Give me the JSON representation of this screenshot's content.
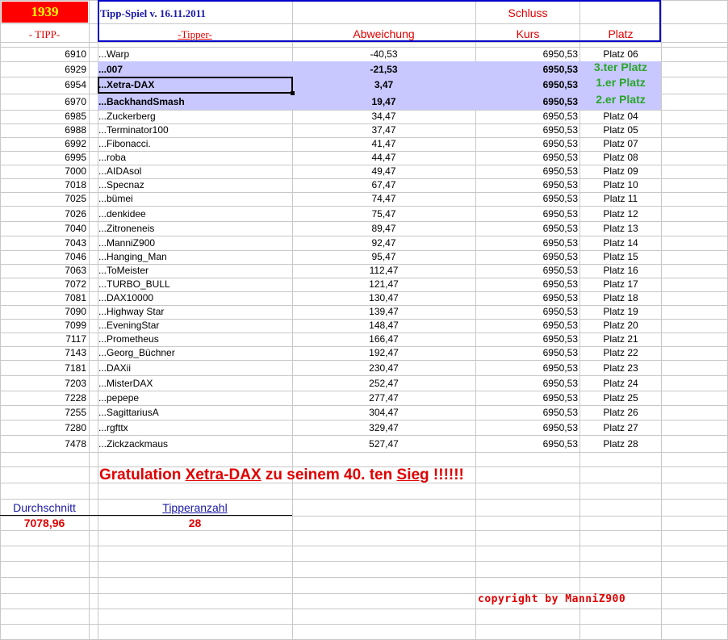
{
  "header": {
    "year": "1939",
    "title": "Tipp-Spiel v. 16.11.2011",
    "schluss": "Schluss",
    "col_tipp": "- TIPP-",
    "col_tipper": "-Tipper-",
    "col_abweichung": "Abweichung",
    "col_kurs": "Kurs",
    "col_platz": "Platz"
  },
  "rows": [
    {
      "tipp": "6910",
      "tipper": "...Warp",
      "abw": "-40,53",
      "kurs": "6950,53",
      "platz": "Platz 06",
      "hl": false,
      "rank": false
    },
    {
      "tipp": "6929",
      "tipper": "...007",
      "abw": "-21,53",
      "kurs": "6950,53",
      "platz": "3.ter Platz",
      "hl": true,
      "rank": true
    },
    {
      "tipp": "6954",
      "tipper": "...Xetra-DAX",
      "abw": "3,47",
      "kurs": "6950,53",
      "platz": "1.er Platz",
      "hl": true,
      "rank": true
    },
    {
      "tipp": "6970",
      "tipper": "...BackhandSmash",
      "abw": "19,47",
      "kurs": "6950,53",
      "platz": "2.er Platz",
      "hl": true,
      "rank": true
    },
    {
      "tipp": "6985",
      "tipper": "...Zuckerberg",
      "abw": "34,47",
      "kurs": "6950,53",
      "platz": "Platz 04",
      "hl": false,
      "rank": false
    },
    {
      "tipp": "6988",
      "tipper": "...Terminator100",
      "abw": "37,47",
      "kurs": "6950,53",
      "platz": "Platz 05",
      "hl": false,
      "rank": false
    },
    {
      "tipp": "6992",
      "tipper": "...Fibonacci.",
      "abw": "41,47",
      "kurs": "6950,53",
      "platz": "Platz 07",
      "hl": false,
      "rank": false
    },
    {
      "tipp": "6995",
      "tipper": "...roba",
      "abw": "44,47",
      "kurs": "6950,53",
      "platz": "Platz 08",
      "hl": false,
      "rank": false
    },
    {
      "tipp": "7000",
      "tipper": "...AIDAsol",
      "abw": "49,47",
      "kurs": "6950,53",
      "platz": "Platz 09",
      "hl": false,
      "rank": false
    },
    {
      "tipp": "7018",
      "tipper": "...Specnaz",
      "abw": "67,47",
      "kurs": "6950,53",
      "platz": "Platz 10",
      "hl": false,
      "rank": false
    },
    {
      "tipp": "7025",
      "tipper": "...bümei",
      "abw": "74,47",
      "kurs": "6950,53",
      "platz": "Platz 11",
      "hl": false,
      "rank": false
    },
    {
      "tipp": "7026",
      "tipper": "...denkidee",
      "abw": "75,47",
      "kurs": "6950,53",
      "platz": "Platz 12",
      "hl": false,
      "rank": false
    },
    {
      "tipp": "7040",
      "tipper": "...Zitroneneis",
      "abw": "89,47",
      "kurs": "6950,53",
      "platz": "Platz 13",
      "hl": false,
      "rank": false
    },
    {
      "tipp": "7043",
      "tipper": "...ManniZ900",
      "abw": "92,47",
      "kurs": "6950,53",
      "platz": "Platz 14",
      "hl": false,
      "rank": false
    },
    {
      "tipp": "7046",
      "tipper": "...Hanging_Man",
      "abw": "95,47",
      "kurs": "6950,53",
      "platz": "Platz 15",
      "hl": false,
      "rank": false
    },
    {
      "tipp": "7063",
      "tipper": "...ToMeister",
      "abw": "112,47",
      "kurs": "6950,53",
      "platz": "Platz 16",
      "hl": false,
      "rank": false
    },
    {
      "tipp": "7072",
      "tipper": "...TURBO_BULL",
      "abw": "121,47",
      "kurs": "6950,53",
      "platz": "Platz 17",
      "hl": false,
      "rank": false
    },
    {
      "tipp": "7081",
      "tipper": "...DAX10000",
      "abw": "130,47",
      "kurs": "6950,53",
      "platz": "Platz 18",
      "hl": false,
      "rank": false
    },
    {
      "tipp": "7090",
      "tipper": "...Highway Star",
      "abw": "139,47",
      "kurs": "6950,53",
      "platz": "Platz 19",
      "hl": false,
      "rank": false
    },
    {
      "tipp": "7099",
      "tipper": "...EveningStar",
      "abw": "148,47",
      "kurs": "6950,53",
      "platz": "Platz 20",
      "hl": false,
      "rank": false
    },
    {
      "tipp": "7117",
      "tipper": "...Prometheus",
      "abw": "166,47",
      "kurs": "6950,53",
      "platz": "Platz 21",
      "hl": false,
      "rank": false
    },
    {
      "tipp": "7143",
      "tipper": "...Georg_Büchner",
      "abw": "192,47",
      "kurs": "6950,53",
      "platz": "Platz 22",
      "hl": false,
      "rank": false
    },
    {
      "tipp": "7181",
      "tipper": "...DAXii",
      "abw": "230,47",
      "kurs": "6950,53",
      "platz": "Platz 23",
      "hl": false,
      "rank": false
    },
    {
      "tipp": "7203",
      "tipper": "...MisterDAX",
      "abw": "252,47",
      "kurs": "6950,53",
      "platz": "Platz 24",
      "hl": false,
      "rank": false
    },
    {
      "tipp": "7228",
      "tipper": "...pepepe",
      "abw": "277,47",
      "kurs": "6950,53",
      "platz": "Platz 25",
      "hl": false,
      "rank": false
    },
    {
      "tipp": "7255",
      "tipper": "...SagittariusA",
      "abw": "304,47",
      "kurs": "6950,53",
      "platz": "Platz 26",
      "hl": false,
      "rank": false
    },
    {
      "tipp": "7280",
      "tipper": "...rgfttx",
      "abw": "329,47",
      "kurs": "6950,53",
      "platz": "Platz 27",
      "hl": false,
      "rank": false
    },
    {
      "tipp": "7478",
      "tipper": "...Zickzackmaus",
      "abw": "527,47",
      "kurs": "6950,53",
      "platz": "Platz 28",
      "hl": false,
      "rank": false
    }
  ],
  "greeting": {
    "part1": "Gratulation ",
    "name": "Xetra-DAX",
    "part2": "  zu seinem 40. ten ",
    "sieg": "Sieg",
    "part3": " !!!!!!"
  },
  "stats": {
    "avg_label": "Durchschnitt",
    "avg_value": "7078,96",
    "count_label": "Tipperanzahl",
    "count_value": "28"
  },
  "copyright": "copyright by ManniZ900",
  "colors": {
    "accent_red": "#e00000",
    "header_blue": "#0000c8",
    "highlight": "#c8c8ff",
    "rank_green": "#2aa52a",
    "year_bg": "#ff0000",
    "year_fg": "#ffff00"
  }
}
